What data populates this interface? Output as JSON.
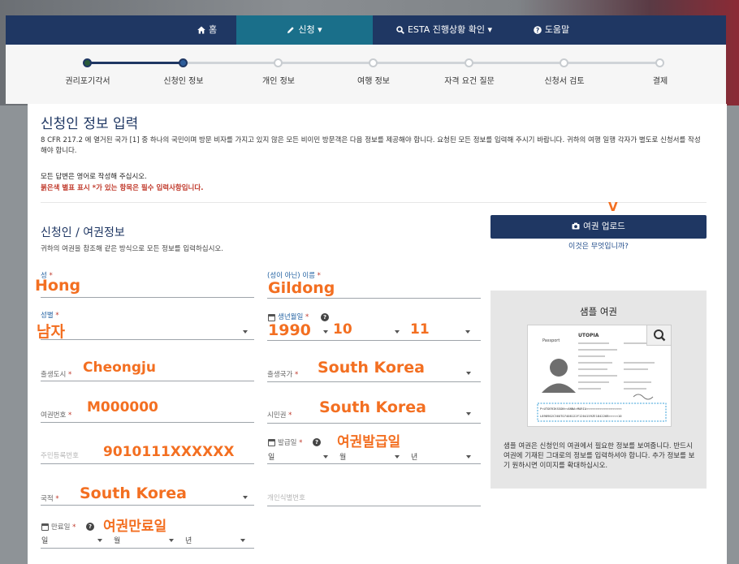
{
  "nav": {
    "items": [
      {
        "label": "홈",
        "icon": "home-icon"
      },
      {
        "label": "신청",
        "icon": "pencil-icon"
      },
      {
        "label": "ESTA 진행상황 확인",
        "icon": "search-icon"
      },
      {
        "label": "도움말",
        "icon": "help-icon"
      }
    ],
    "active_index": 1
  },
  "steps": {
    "items": [
      "권리포기각서",
      "신청인 정보",
      "개인 정보",
      "여행 정보",
      "자격 요건 질문",
      "신청서 검토",
      "결제"
    ],
    "current_index": 1
  },
  "page": {
    "title": "신청인 정보 입력",
    "intro": "8 CFR 217.2 에 열거된 국가 [1] 중 하나의 국민이며 방문 비자를 가지고 있지 않은 모든 비이민 방문객은 다음 정보를 제공해야 합니다. 요청된 모든 정보를 입력해 주시기 바랍니다. 귀하의 여행 일행 각자가 별도로 신청서를 작성해야 합니다.",
    "note_english": "모든 답변은 영어로 작성해 주십시오.",
    "note_required": "붉은색 별표 표시 *가 있는 항목은 필수 입력사항입니다.",
    "section_title": "신청인 / 여권정보",
    "section_sub": "귀하의 여권을 참조해 같은 방식으로 모든 정보를 입력하십시오."
  },
  "upload": {
    "button_label": "여권 업로드",
    "help_link": "이것은 무엇입니까?",
    "annotation": "V"
  },
  "fields": {
    "surname_label": "성",
    "surname_value": "Hong",
    "given_label": "(성이 아닌) 이름",
    "given_value": "Gildong",
    "gender_label": "성별",
    "gender_value": "남자",
    "birth_label": "생년월일",
    "birth_year": "1990",
    "birth_month": "10",
    "birth_day": "11",
    "birth_city_label": "출생도시",
    "birth_city_value": "Cheongju",
    "birth_country_label": "출생국가",
    "birth_country_value": "South Korea",
    "passport_label": "여권번호",
    "passport_value": "M000000",
    "citizenship_label": "시민권",
    "citizenship_value": "South Korea",
    "national_id_placeholder": "주민등록번호",
    "national_id_value": "9010111XXXXXX",
    "issue_label": "발급일",
    "issue_value": "여권발급일",
    "issue_day": "일",
    "issue_month": "월",
    "issue_year": "년",
    "nationality_label": "국적",
    "nationality_value": "South Korea",
    "personal_id_placeholder": "개인식별번호",
    "expiry_label": "만료일",
    "expiry_value": "여권만료일",
    "expiry_day": "일",
    "expiry_month": "월",
    "expiry_year": "년"
  },
  "sample": {
    "title": "샘플 여권",
    "passport_country": "UTOPIA",
    "passport_word": "Passport",
    "mrz_line1": "P<UTOERIKSSON<<ANNA<MARIA<<<<<<<<<<<<<<<<<<<",
    "mrz_line2": "L898902C36UTO7408122F1204159ZE184226B<<<<<10",
    "description": "샘플 여권은 신청인의 여권에서 필요한 정보를 보여줍니다. 반드시 여권에 기재된 그대로의 정보를 입력하셔야 합니다. 추가 정보를 보기 원하시면 이미지를 확대하십시오."
  },
  "colors": {
    "nav_bg": "#1f3763",
    "nav_active": "#1a6f8a",
    "annotation": "#f36f21",
    "required": "#c0392b"
  }
}
